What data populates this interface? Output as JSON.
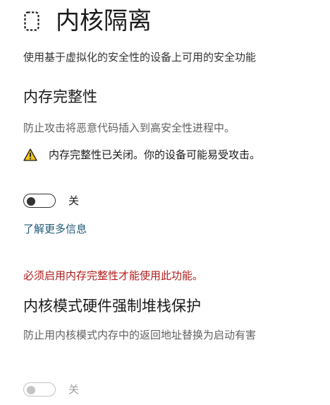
{
  "page": {
    "title": "内核隔离",
    "description": "使用基于虚拟化的安全性的设备上可用的安全功能"
  },
  "memory_integrity": {
    "title": "内存完整性",
    "description": "防止攻击将恶意代码插入到高安全性进程中。",
    "warning": "内存完整性已关闭。你的设备可能易受攻击。",
    "toggle_label": "关",
    "toggle_on": false,
    "learn_more": "了解更多信息"
  },
  "stack_protection": {
    "requirement": "必须启用内存完整性才能使用此功能。",
    "title": "内核模式硬件强制堆栈保护",
    "description": "防止用内核模式内存中的返回地址替换为启动有害",
    "toggle_label": "关",
    "toggle_on": false,
    "toggle_enabled": false
  },
  "icons": {
    "header": "core-isolation-chip-icon",
    "warning": "warning-triangle-icon"
  },
  "colors": {
    "warning_fill": "#f0c419",
    "link": "#1f5a78",
    "error": "#b01c1c"
  }
}
